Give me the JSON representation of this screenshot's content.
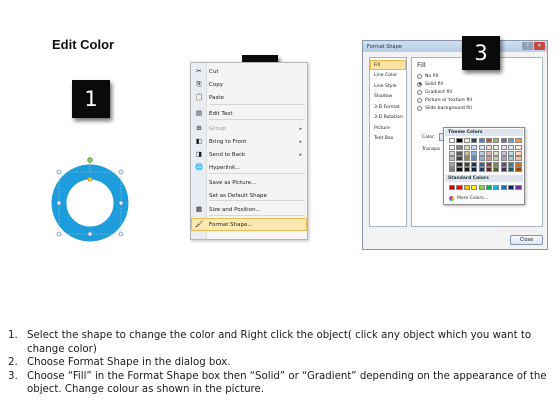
{
  "title": "Edit Color",
  "steps_markers": [
    "1",
    "2",
    "3"
  ],
  "shape_color": "#1e9ddc",
  "context_menu": {
    "items": [
      {
        "icon": "scissors-icon",
        "glyph": "✂",
        "label": "Cut",
        "enabled": true,
        "submenu": false
      },
      {
        "icon": "copy-icon",
        "glyph": "⎘",
        "label": "Copy",
        "enabled": true,
        "submenu": false
      },
      {
        "icon": "paste-icon",
        "glyph": "📋",
        "label": "Paste",
        "enabled": true,
        "submenu": false
      },
      {
        "icon": "edit-text-icon",
        "glyph": "▤",
        "label": "Edit Text",
        "enabled": true,
        "submenu": false
      },
      {
        "icon": "group-icon",
        "glyph": "⊞",
        "label": "Group",
        "enabled": false,
        "submenu": true
      },
      {
        "icon": "bring-to-front-icon",
        "glyph": "◧",
        "label": "Bring to Front",
        "enabled": true,
        "submenu": true
      },
      {
        "icon": "send-to-back-icon",
        "glyph": "◨",
        "label": "Send to Back",
        "enabled": true,
        "submenu": true
      },
      {
        "icon": "hyperlink-icon",
        "glyph": "🌐",
        "label": "Hyperlink...",
        "enabled": true,
        "submenu": false
      },
      {
        "icon": "",
        "glyph": "",
        "label": "Save as Picture...",
        "enabled": true,
        "submenu": false
      },
      {
        "icon": "",
        "glyph": "",
        "label": "Set as Default Shape",
        "enabled": true,
        "submenu": false
      },
      {
        "icon": "size-position-icon",
        "glyph": "▦",
        "label": "Size and Position...",
        "enabled": true,
        "submenu": false
      },
      {
        "icon": "format-shape-icon",
        "glyph": "🖌",
        "label": "Format Shape...",
        "enabled": true,
        "submenu": false,
        "highlighted": true
      }
    ]
  },
  "dialog": {
    "title": "Format Shape",
    "nav": [
      "Fill",
      "Line Color",
      "Line Style",
      "Shadow",
      "3-D Format",
      "3-D Rotation",
      "Picture",
      "Text Box"
    ],
    "selected_nav": "Fill",
    "pane_title": "Fill",
    "fill_options": [
      {
        "label": "No fill",
        "checked": false
      },
      {
        "label": "Solid fill",
        "checked": true
      },
      {
        "label": "Gradient fill",
        "checked": false
      },
      {
        "label": "Picture or texture fill",
        "checked": false
      },
      {
        "label": "Slide background fill",
        "checked": false
      }
    ],
    "color_label": "Color:",
    "transparency_label": "Transpa",
    "close_label": "Close"
  },
  "color_picker": {
    "theme_header": "Theme Colors",
    "standard_header": "Standard Colors",
    "more_label": "More Colors...",
    "theme_top": [
      "#ffffff",
      "#000000",
      "#eeece1",
      "#1f497d",
      "#4f81bd",
      "#c0504d",
      "#9bbb59",
      "#8064a2",
      "#4bacc6",
      "#f79646"
    ],
    "theme_shades": [
      [
        "#f2f2f2",
        "#7f7f7f",
        "#ddd9c3",
        "#c6d9f0",
        "#dbe5f1",
        "#f2dcdb",
        "#ebf1dd",
        "#e5e0ec",
        "#dbeef3",
        "#fdeada"
      ],
      [
        "#d8d8d8",
        "#595959",
        "#c4bd97",
        "#8db3e2",
        "#b8cce4",
        "#e5b9b7",
        "#d7e3bc",
        "#ccc1d9",
        "#b7dde8",
        "#fbd5b5"
      ],
      [
        "#bfbfbf",
        "#3f3f3f",
        "#938953",
        "#548dd4",
        "#95b3d7",
        "#d99694",
        "#c3d69b",
        "#b2a2c7",
        "#92cddc",
        "#fac08f"
      ],
      [
        "#a5a5a5",
        "#262626",
        "#494429",
        "#17365d",
        "#366092",
        "#953734",
        "#76923c",
        "#5f497a",
        "#31859b",
        "#e36c09"
      ],
      [
        "#7f7f7f",
        "#0c0c0c",
        "#1d1b10",
        "#0f243e",
        "#244061",
        "#632423",
        "#4f6128",
        "#3f3151",
        "#205867",
        "#974806"
      ]
    ],
    "standard": [
      "#c00000",
      "#ff0000",
      "#ffc000",
      "#ffff00",
      "#92d050",
      "#00b050",
      "#00b0f0",
      "#0070c0",
      "#002060",
      "#7030a0"
    ]
  },
  "instructions": [
    {
      "num": "1.",
      "text": "Select the shape to change the color and Right click the object( click any object which you want to change color)"
    },
    {
      "num": "2.",
      "text": "Choose Format Shape in the dialog box."
    },
    {
      "num": "3.",
      "text": "Choose “Fill” in the Format Shape box then “Solid” or “Gradient” depending on the appearance of the object. Change colour as shown in the picture."
    }
  ]
}
